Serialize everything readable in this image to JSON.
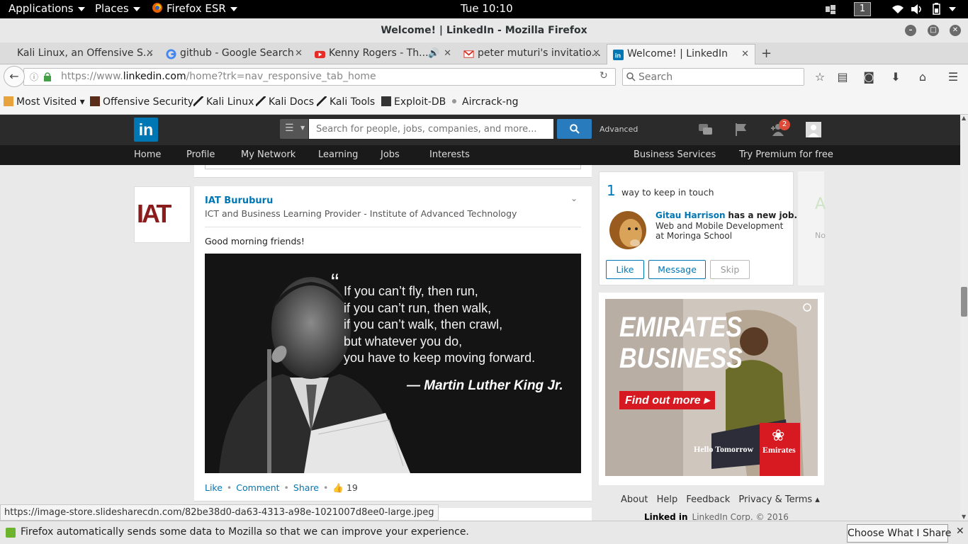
{
  "system_bar": {
    "applications": "Applications",
    "places": "Places",
    "firefox": "Firefox ESR",
    "clock": "Tue 10:10",
    "workspace": "1"
  },
  "window": {
    "title": "Welcome! | LinkedIn - Mozilla Firefox"
  },
  "tabs": [
    {
      "label": "Kali Linux, an Offensive S...",
      "icon": "kali-icon"
    },
    {
      "label": "github - Google Search",
      "icon": "google-icon"
    },
    {
      "label": "Kenny Rogers - Th...",
      "icon": "youtube-icon"
    },
    {
      "label": "peter muturi's invitatio...",
      "icon": "gmail-icon"
    },
    {
      "label": "Welcome! | LinkedIn",
      "icon": "linkedin-icon",
      "active": true
    }
  ],
  "navbar": {
    "url_prefix": "https://www.",
    "url_domain": "linkedin.com",
    "url_path": "/home?trk=nav_responsive_tab_home",
    "search_placeholder": "Search"
  },
  "bookmarks": [
    {
      "label": "Most Visited ▾"
    },
    {
      "label": "Offensive Security"
    },
    {
      "label": "Kali Linux"
    },
    {
      "label": "Kali Docs"
    },
    {
      "label": "Kali Tools"
    },
    {
      "label": "Exploit-DB"
    },
    {
      "label": "Aircrack-ng"
    }
  ],
  "linkedin": {
    "logo": "in",
    "search_placeholder": "Search for people, jobs, companies, and more...",
    "advanced": "Advanced",
    "notifications_count": "2",
    "nav": {
      "home": "Home",
      "profile": "Profile",
      "my_network": "My Network",
      "learning": "Learning",
      "jobs": "Jobs",
      "interests": "Interests",
      "business_services": "Business Services",
      "premium": "Try Premium for free"
    },
    "post": {
      "company_logo_text": "IAT",
      "author": "IAT Buruburu",
      "headline": "ICT and Business Learning Provider - Institute of Advanced Technology",
      "message": "Good morning friends!",
      "quote_lines": [
        "If you can’t fly, then run,",
        "if you can’t run, then walk,",
        "if you can’t walk, then crawl,",
        "but whatever you do,",
        "you have to keep moving forward."
      ],
      "quote_author": "— Martin Luther King Jr.",
      "actions": {
        "like": "Like",
        "comment": "Comment",
        "share": "Share",
        "likes_count": "19"
      }
    },
    "pymk": {
      "count": "1",
      "title": "way to keep in touch",
      "person_name": "Gitau Harrison",
      "person_update": "has a new job.",
      "job": "Web and Mobile Development at Moringa School",
      "like": "Like",
      "message": "Message",
      "skip": "Skip"
    },
    "side_partial": {
      "letter": "A",
      "text": "No"
    },
    "ad": {
      "headline_1": "EMIRATES",
      "headline_2": "BUSINESS",
      "cta": "Find out more ▸",
      "tagline": "Hello Tomorrow",
      "brand": "Emirates"
    },
    "footer": {
      "links": [
        "About",
        "Help",
        "Feedback",
        "Privacy & Terms ▴"
      ],
      "brand": "Linked in",
      "copyright": "LinkedIn Corp. © 2016"
    }
  },
  "status_url": "https://image-store.slidesharecdn.com/82be38d0-da63-4313-a98e-1021007d8ee0-large.jpeg",
  "notification": {
    "message": "Firefox automatically sends some data to Mozilla so that we can improve your experience.",
    "button": "Choose What I Share"
  },
  "colors": {
    "linkedin_blue": "#0077b5",
    "header_dark": "#2b2b2b",
    "emirates_red": "#d71921"
  }
}
